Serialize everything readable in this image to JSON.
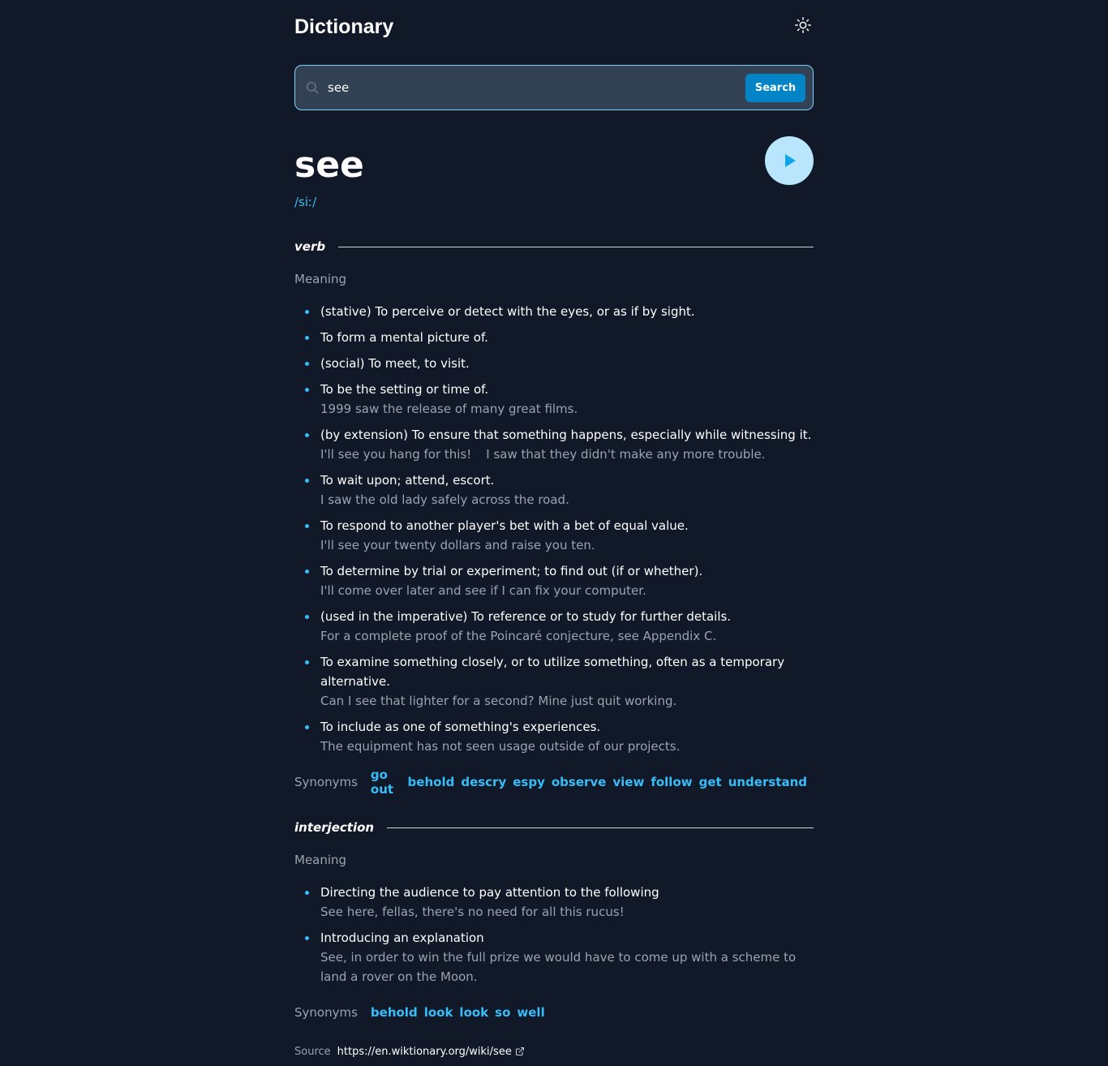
{
  "app": {
    "title": "Dictionary"
  },
  "search": {
    "value": "see",
    "button_label": "Search"
  },
  "entry": {
    "word": "see",
    "phonetic": "/siː/"
  },
  "meanings": [
    {
      "part_of_speech": "verb",
      "heading": "Meaning",
      "definitions": [
        {
          "text": "(stative) To perceive or detect with the eyes, or as if by sight.",
          "examples": []
        },
        {
          "text": "To form a mental picture of.",
          "examples": []
        },
        {
          "text": "(social) To meet, to visit.",
          "examples": []
        },
        {
          "text": "To be the setting or time of.",
          "examples": [
            "1999 saw the release of many great films."
          ]
        },
        {
          "text": "(by extension) To ensure that something happens, especially while witnessing it.",
          "examples": [
            "I'll see you hang for this!",
            "I saw that they didn't make any more trouble."
          ]
        },
        {
          "text": "To wait upon; attend, escort.",
          "examples": [
            "I saw the old lady safely across the road."
          ]
        },
        {
          "text": "To respond to another player's bet with a bet of equal value.",
          "examples": [
            "I'll see your twenty dollars and raise you ten."
          ]
        },
        {
          "text": "To determine by trial or experiment; to find out (if or whether).",
          "examples": [
            "I'll come over later and see if I can fix your computer."
          ]
        },
        {
          "text": "(used in the imperative) To reference or to study for further details.",
          "examples": [
            "For a complete proof of the Poincaré conjecture, see Appendix C."
          ]
        },
        {
          "text": "To examine something closely, or to utilize something, often as a temporary alternative.",
          "examples": [
            "Can I see that lighter for a second? Mine just quit working."
          ]
        },
        {
          "text": "To include as one of something's experiences.",
          "examples": [
            "The equipment has not seen usage outside of our projects."
          ]
        }
      ],
      "synonyms_heading": "Synonyms",
      "synonyms": [
        "go out",
        "behold",
        "descry",
        "espy",
        "observe",
        "view",
        "follow",
        "get",
        "understand"
      ]
    },
    {
      "part_of_speech": "interjection",
      "heading": "Meaning",
      "definitions": [
        {
          "text": "Directing the audience to pay attention to the following",
          "examples": [
            "See here, fellas, there's no need for all this rucus!"
          ]
        },
        {
          "text": "Introducing an explanation",
          "examples": [
            "See, in order to win the full prize we would have to come up with a scheme to land a rover on the Moon."
          ]
        }
      ],
      "synonyms_heading": "Synonyms",
      "synonyms": [
        "behold",
        "look",
        "look",
        "so",
        "well"
      ]
    }
  ],
  "source": {
    "label": "Source",
    "url": "https://en.wiktionary.org/wiki/see"
  },
  "icons": {
    "theme": "sun-icon",
    "search": "search-icon",
    "play": "play-icon",
    "external": "external-link-icon"
  },
  "colors": {
    "background": "#111827",
    "accent": "#38bdf8",
    "button": "#0284c7",
    "muted": "#9ca3af",
    "search_bg": "#334155",
    "play_bg": "#bae6fd"
  }
}
